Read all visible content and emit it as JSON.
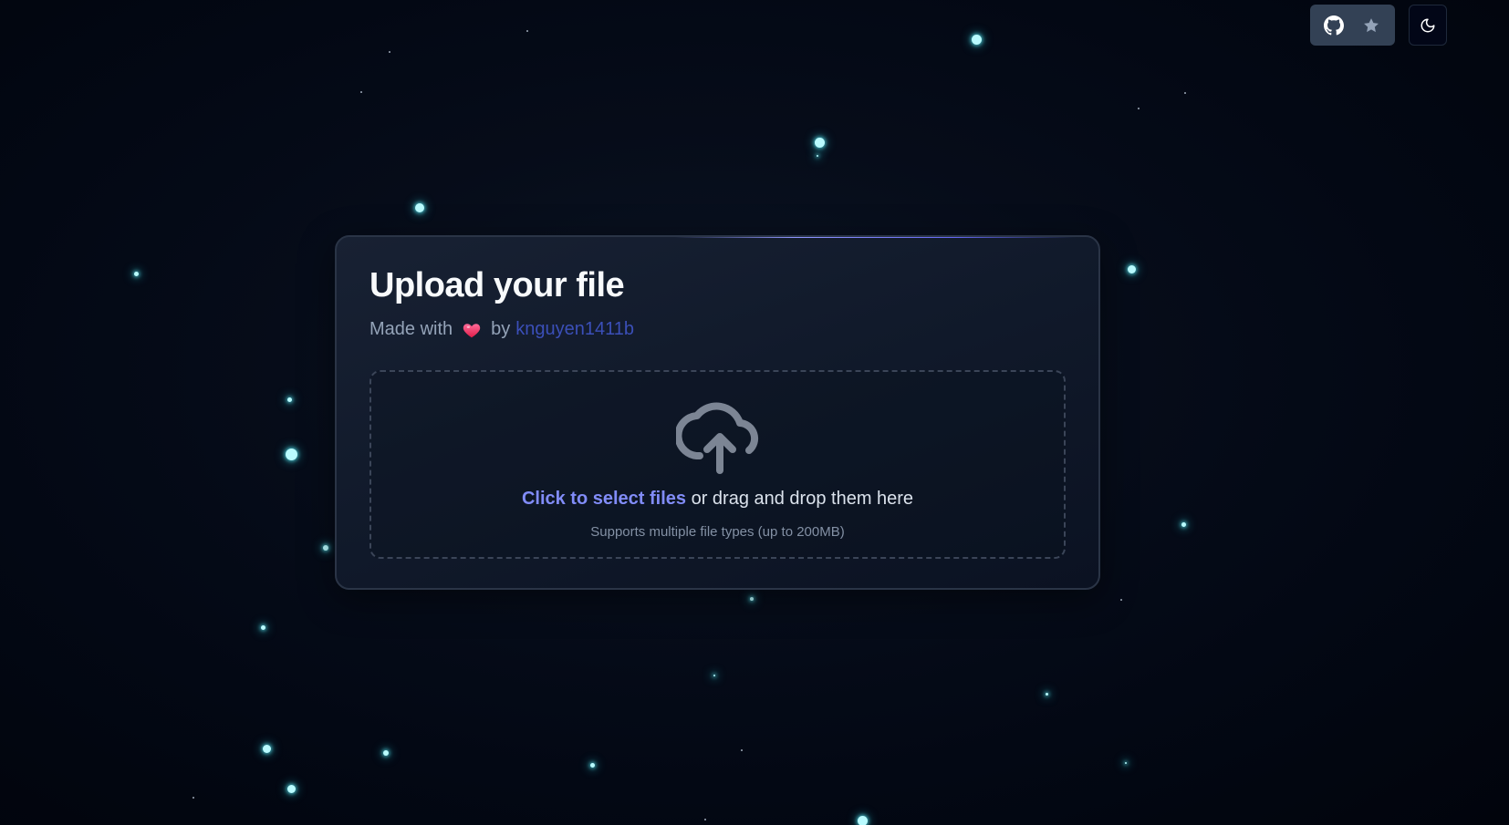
{
  "colors": {
    "background": "#020617",
    "accent": "#818cf8",
    "link": "#3b4fb8",
    "star": "#b9fbff"
  },
  "header": {
    "github_button_icon": "github-icon",
    "star_button_icon": "star-icon",
    "theme_toggle_icon": "moon-icon"
  },
  "upload_card": {
    "title": "Upload your file",
    "credit": {
      "prefix": "Made with",
      "heart_icon": "heart-icon",
      "by": "by",
      "author": "knguyen1411b"
    },
    "dropzone": {
      "icon": "cloud-upload-icon",
      "select_label": "Click to select files",
      "drag_text": " or drag and drop them here",
      "hint": "Supports multiple file types (up to 200MB)"
    }
  }
}
